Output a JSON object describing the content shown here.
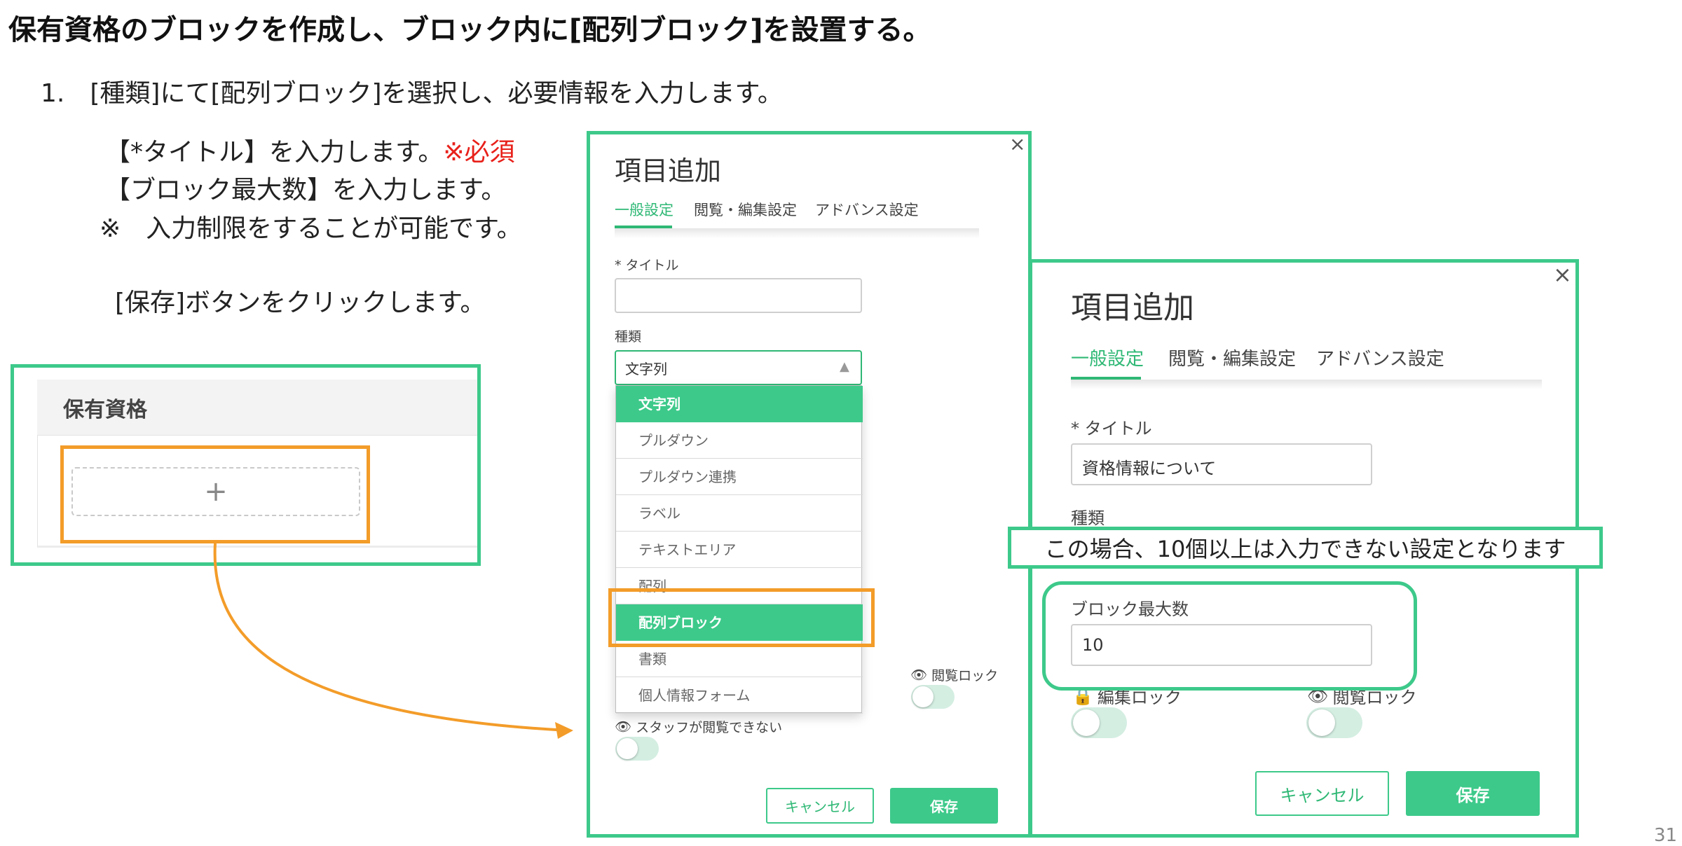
{
  "page": {
    "title": "保有資格のブロックを作成し、ブロック内に[配列ブロック]を設置する。",
    "step": "1.　[種類]にて[配列ブロック]を選択し、必要情報を入力します。",
    "instructions": {
      "line1": "【*タイトル】を入力します。",
      "line1_required": "※必須",
      "line2": "【ブロック最大数】を入力します。",
      "line3": "※　入力制限をすることが可能です。",
      "line4": "[保存]ボタンをクリックします。"
    },
    "page_number": "31"
  },
  "left_panel": {
    "title": "保有資格",
    "add_symbol": "+"
  },
  "dialog1": {
    "close": "×",
    "title": "項目追加",
    "tabs": [
      "一般設定",
      "閲覧・編集設定",
      "アドバンス設定"
    ],
    "title_label": "* タイトル",
    "title_value": "",
    "type_label": "種類",
    "type_value": "文字列",
    "options": [
      "文字列",
      "プルダウン",
      "プルダウン連携",
      "ラベル",
      "テキストエリア",
      "配列",
      "配列ブロック",
      "書類",
      "個人情報フォーム"
    ],
    "view_lock_label": "閲覧ロック",
    "staff_hidden_label": "スタッフが閲覧できない",
    "cancel_label": "キャンセル",
    "save_label": "保存"
  },
  "dialog2": {
    "close": "×",
    "title": "項目追加",
    "tabs": [
      "一般設定",
      "閲覧・編集設定",
      "アドバンス設定"
    ],
    "title_label": "* タイトル",
    "title_value": "資格情報について",
    "type_label": "種類",
    "max_blocks_label": "ブロック最大数",
    "max_blocks_value": "10",
    "edit_lock_label": "編集ロック",
    "view_lock_label": "閲覧ロック",
    "cancel_label": "キャンセル",
    "save_label": "保存"
  },
  "callout": {
    "note": "この場合、10個以上は入力できない設定となります"
  },
  "colors": {
    "green": "#3dc98a",
    "orange": "#f39c29",
    "required_red": "#e8201a"
  }
}
